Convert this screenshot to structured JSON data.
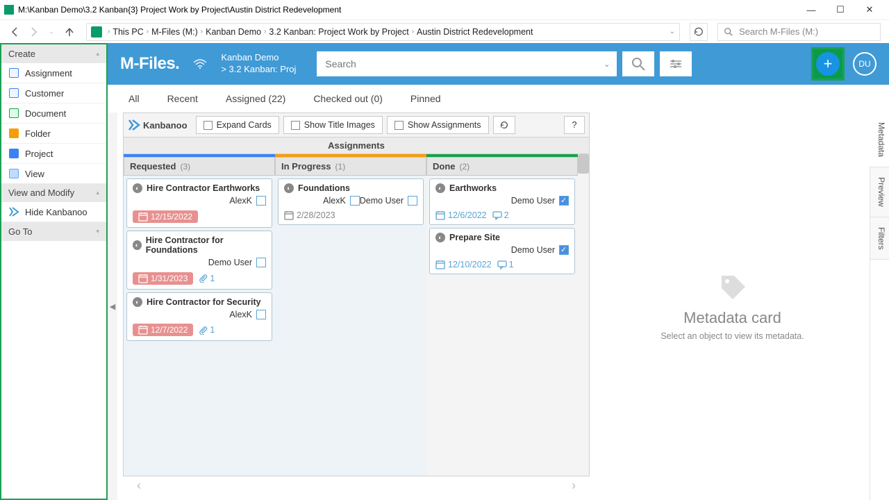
{
  "window": {
    "title": "M:\\Kanban Demo\\3.2 Kanban{3} Project Work by Project\\Austin District Redevelopment"
  },
  "breadcrumb": {
    "items": [
      "This PC",
      "M-Files (M:)",
      "Kanban Demo",
      "3.2 Kanban: Project Work by Project",
      "Austin District Redevelopment"
    ]
  },
  "explorer_search": {
    "placeholder": "Search M-Files (M:)"
  },
  "sidebar": {
    "create_label": "Create",
    "create_items": [
      {
        "label": "Assignment",
        "icon": "assign"
      },
      {
        "label": "Customer",
        "icon": "cust"
      },
      {
        "label": "Document",
        "icon": "doc"
      },
      {
        "label": "Folder",
        "icon": "folder"
      },
      {
        "label": "Project",
        "icon": "proj"
      },
      {
        "label": "View",
        "icon": "view"
      }
    ],
    "view_modify_label": "View and Modify",
    "hide_kanbanoo_label": "Hide Kanbanoo",
    "goto_label": "Go To"
  },
  "header": {
    "logo": "M-Files.",
    "path_line1": "Kanban Demo",
    "path_line2": "> 3.2 Kanban: Proj",
    "search_placeholder": "Search",
    "avatar": "DU"
  },
  "tabs": {
    "all": "All",
    "recent": "Recent",
    "assigned": "Assigned (22)",
    "checked_out": "Checked out (0)",
    "pinned": "Pinned"
  },
  "toolbar": {
    "brand": "Kanbanoo",
    "expand_cards": "Expand Cards",
    "show_title_images": "Show Title Images",
    "show_assignments": "Show Assignments",
    "help": "?"
  },
  "kanban": {
    "title": "Assignments",
    "columns": [
      {
        "name": "Requested",
        "count": "(3)",
        "bar": "blue",
        "cards": [
          {
            "title": "Hire Contractor Earthworks",
            "assignees": [
              {
                "name": "AlexK",
                "done": false
              }
            ],
            "date": "12/15/2022",
            "date_overdue": true
          },
          {
            "title": "Hire Contractor for Foundations",
            "assignees": [
              {
                "name": "Demo User",
                "done": false
              }
            ],
            "date": "1/31/2023",
            "date_overdue": true,
            "attachments": "1"
          },
          {
            "title": "Hire Contractor for Security",
            "assignees": [
              {
                "name": "AlexK",
                "done": false
              }
            ],
            "date": "12/7/2022",
            "date_overdue": true,
            "attachments": "1"
          }
        ]
      },
      {
        "name": "In Progress",
        "count": "(1)",
        "bar": "orange",
        "cards": [
          {
            "title": "Foundations",
            "assignees": [
              {
                "name": "AlexK",
                "done": false
              },
              {
                "name": "Demo User",
                "done": false
              }
            ],
            "date": "2/28/2023",
            "date_overdue": false
          }
        ]
      },
      {
        "name": "Done",
        "count": "(2)",
        "bar": "green",
        "done_col": true,
        "cards": [
          {
            "title": "Earthworks",
            "assignees": [
              {
                "name": "Demo User",
                "done": true
              }
            ],
            "date": "12/6/2022",
            "date_blue": true,
            "comments": "2"
          },
          {
            "title": "Prepare Site",
            "assignees": [
              {
                "name": "Demo User",
                "done": true
              }
            ],
            "date": "12/10/2022",
            "date_blue": true,
            "comments": "1"
          }
        ]
      }
    ]
  },
  "meta": {
    "title": "Metadata card",
    "sub": "Select an object to view its metadata."
  },
  "side_tabs": {
    "metadata": "Metadata",
    "preview": "Preview",
    "filters": "Filters"
  }
}
